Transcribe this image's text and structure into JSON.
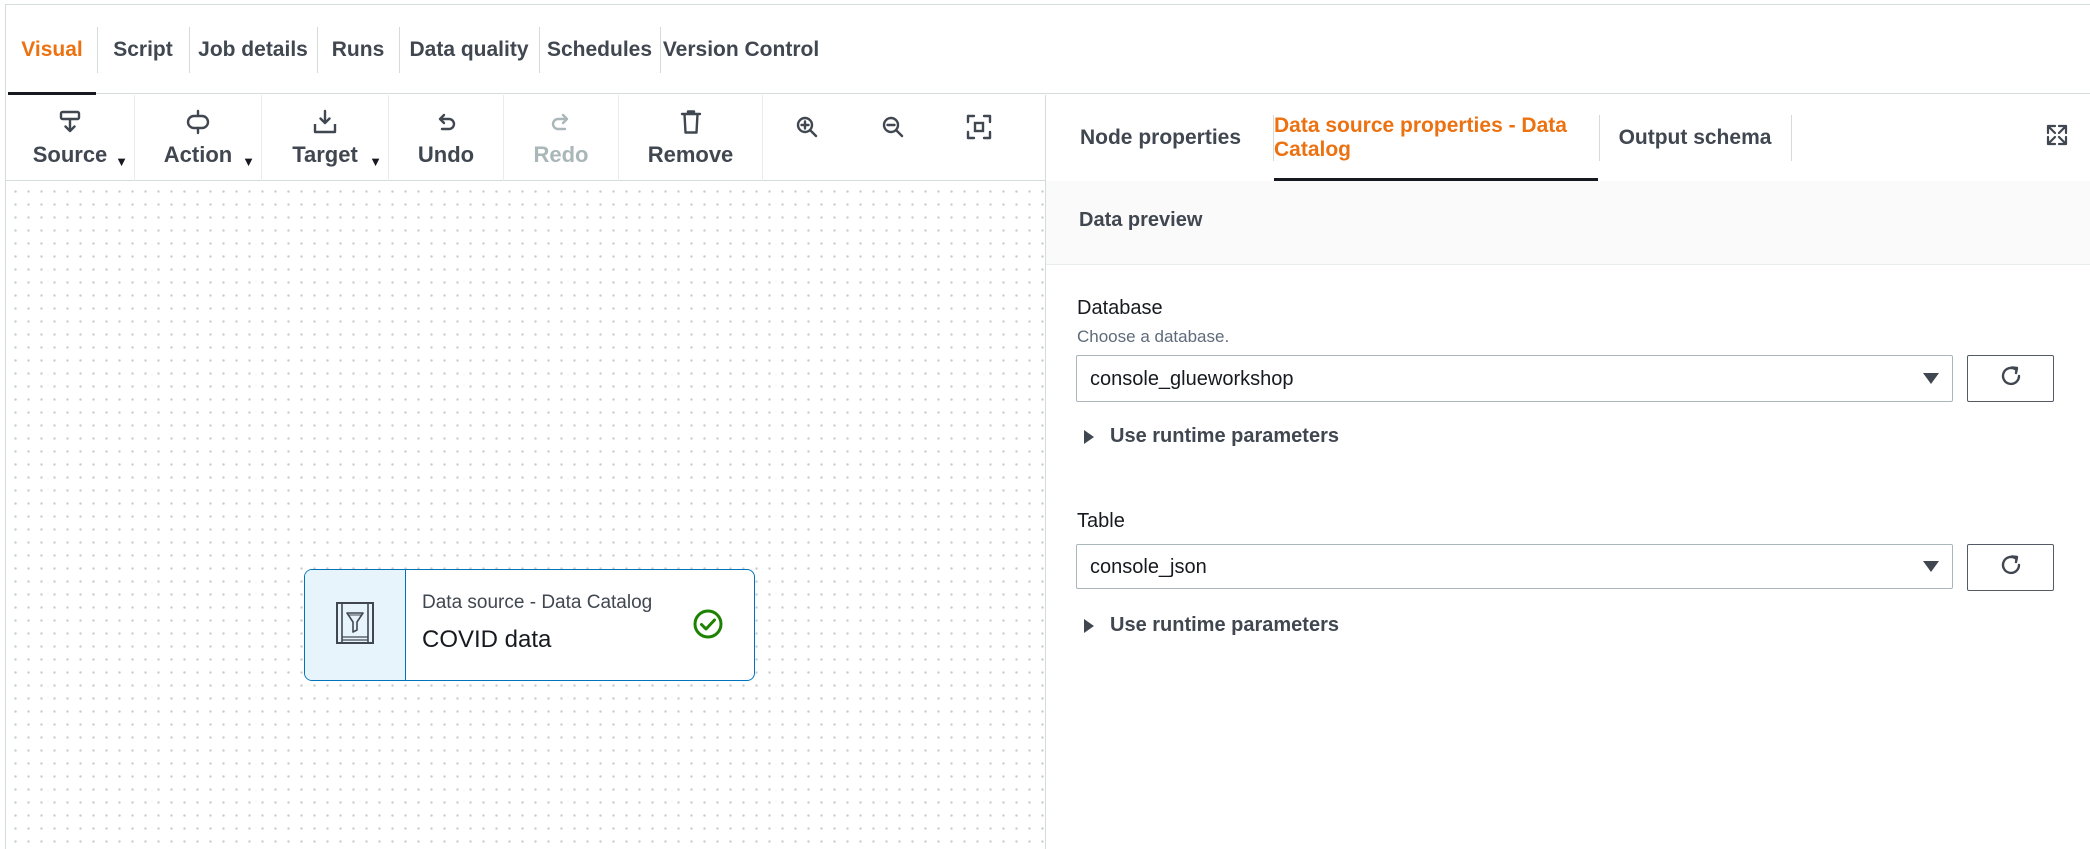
{
  "top_tabs": [
    {
      "label": "Visual"
    },
    {
      "label": "Script"
    },
    {
      "label": "Job details"
    },
    {
      "label": "Runs"
    },
    {
      "label": "Data quality"
    },
    {
      "label": "Schedules"
    },
    {
      "label": "Version Control"
    }
  ],
  "active_top_tab": "Visual",
  "toolbar": {
    "source": "Source",
    "action": "Action",
    "target": "Target",
    "undo": "Undo",
    "redo": "Redo",
    "remove": "Remove",
    "zoom_in_icon": "zoom-in-icon",
    "zoom_out_icon": "zoom-out-icon",
    "fit_icon": "fit-to-screen-icon"
  },
  "canvas": {
    "node": {
      "kind": "Data source - Data Catalog",
      "title": "COVID data",
      "status": "valid"
    }
  },
  "panel": {
    "tabs": [
      {
        "label": "Node properties"
      },
      {
        "label": "Data source properties - Data Catalog"
      },
      {
        "label": "Output schema"
      }
    ],
    "active_tab": "Data source properties - Data Catalog",
    "preview_label": "Data preview",
    "database": {
      "label": "Database",
      "description": "Choose a database.",
      "value": "console_glueworkshop"
    },
    "database_runtime": "Use runtime parameters",
    "table": {
      "label": "Table",
      "value": "console_json"
    },
    "table_runtime": "Use runtime parameters"
  },
  "colors": {
    "accent": "#ec7211",
    "node_border": "#0073bb",
    "success": "#1d8102"
  }
}
